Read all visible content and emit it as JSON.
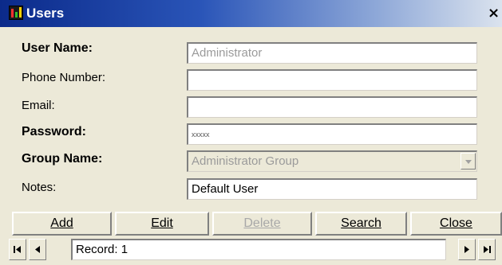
{
  "window": {
    "title": "Users",
    "close_glyph": "×",
    "icon": "app-chart-icon"
  },
  "form": {
    "user_name": {
      "label": "User Name:",
      "value": "Administrator"
    },
    "phone_number": {
      "label": "Phone Number:",
      "value": ""
    },
    "email": {
      "label": "Email:",
      "value": ""
    },
    "password": {
      "label": "Password:",
      "value": "xxxxx"
    },
    "group_name": {
      "label": "Group Name:",
      "value": "Administrator Group"
    },
    "notes": {
      "label": "Notes:",
      "value": "Default User"
    }
  },
  "buttons": {
    "add": "Add",
    "edit": "Edit",
    "delete": "Delete",
    "search": "Search",
    "close": "Close"
  },
  "navigator": {
    "record_text": "Record: 1",
    "first_icon": "first-record-icon",
    "prev_icon": "previous-record-icon",
    "next_icon": "next-record-icon",
    "last_icon": "last-record-icon"
  }
}
